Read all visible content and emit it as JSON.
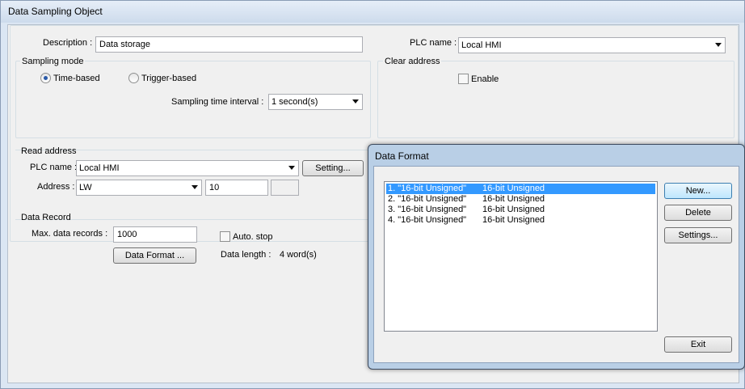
{
  "window": {
    "title": "Data Sampling Object"
  },
  "general": {
    "description_label": "Description :",
    "description_value": "Data storage",
    "plc_name_label": "PLC name :",
    "plc_name_value": "Local HMI"
  },
  "sampling_mode": {
    "title": "Sampling mode",
    "options": [
      {
        "label": "Time-based",
        "selected": true
      },
      {
        "label": "Trigger-based",
        "selected": false
      }
    ],
    "interval_label": "Sampling time interval :",
    "interval_value": "1 second(s)"
  },
  "clear_address": {
    "title": "Clear address",
    "enable_label": "Enable",
    "enabled": false
  },
  "read_address": {
    "title": "Read address",
    "plc_name_label": "PLC name :",
    "plc_name_value": "Local HMI",
    "setting_button": "Setting...",
    "address_label": "Address :",
    "address_type": "LW",
    "address_value": "10"
  },
  "data_record": {
    "title": "Data Record",
    "max_records_label": "Max. data records :",
    "max_records_value": "1000",
    "auto_stop_label": "Auto. stop",
    "auto_stop_checked": false,
    "data_format_button": "Data Format ...",
    "data_length_label": "Data length :",
    "data_length_value": "4 word(s)"
  },
  "data_format_dialog": {
    "title": "Data Format",
    "items": [
      {
        "name": "1. \"16-bit Unsigned\"",
        "type": "16-bit Unsigned",
        "selected": true
      },
      {
        "name": "2. \"16-bit Unsigned\"",
        "type": "16-bit Unsigned",
        "selected": false
      },
      {
        "name": "3. \"16-bit Unsigned\"",
        "type": "16-bit Unsigned",
        "selected": false
      },
      {
        "name": "4. \"16-bit Unsigned\"",
        "type": "16-bit Unsigned",
        "selected": false
      }
    ],
    "buttons": {
      "new": "New...",
      "delete": "Delete",
      "settings": "Settings...",
      "exit": "Exit"
    }
  }
}
